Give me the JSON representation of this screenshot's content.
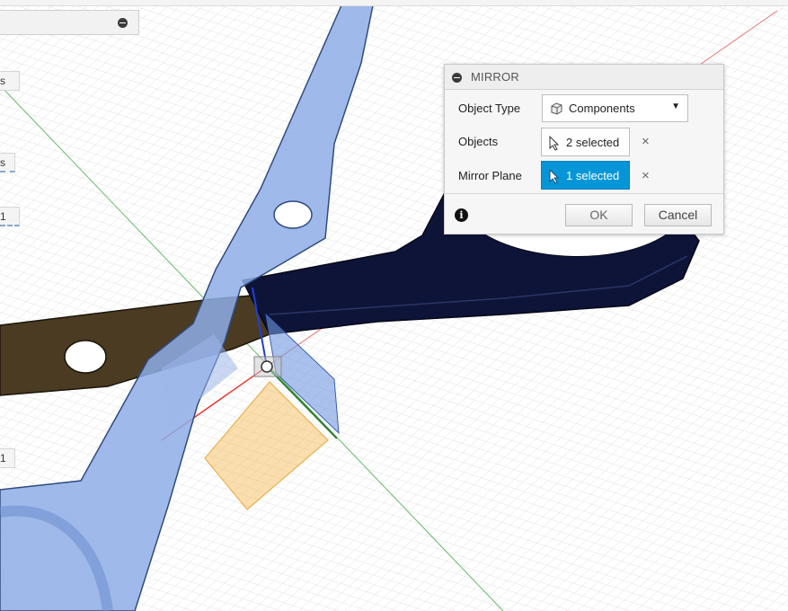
{
  "browser_panel": {
    "chips": [
      "s",
      "s",
      "1",
      "1"
    ]
  },
  "mirror_dialog": {
    "title": "MIRROR",
    "object_type": {
      "label": "Object Type",
      "value": "Components"
    },
    "objects": {
      "label": "Objects",
      "value": "2 selected"
    },
    "mirror_plane": {
      "label": "Mirror Plane",
      "value": "1 selected"
    },
    "clear_symbol": "×",
    "info_symbol": "i",
    "ok_label": "OK",
    "cancel_label": "Cancel"
  },
  "colors": {
    "selection_active": "#0696d7",
    "blade_selected": "#8eaee6",
    "blade_dark": "#4a3b22",
    "handle_dark": "#0e1438",
    "mirror_plane": "#f7b64a",
    "axis_x": "#e53935",
    "axis_y": "#43a047",
    "axis_z": "#1e3fd6"
  },
  "icons": {
    "panel_collapse": "minus-circle-icon",
    "dialog_collapse": "minus-circle-icon",
    "component": "cube-icon",
    "select": "cursor-arrow-icon",
    "clear": "close-icon",
    "info": "info-icon"
  }
}
